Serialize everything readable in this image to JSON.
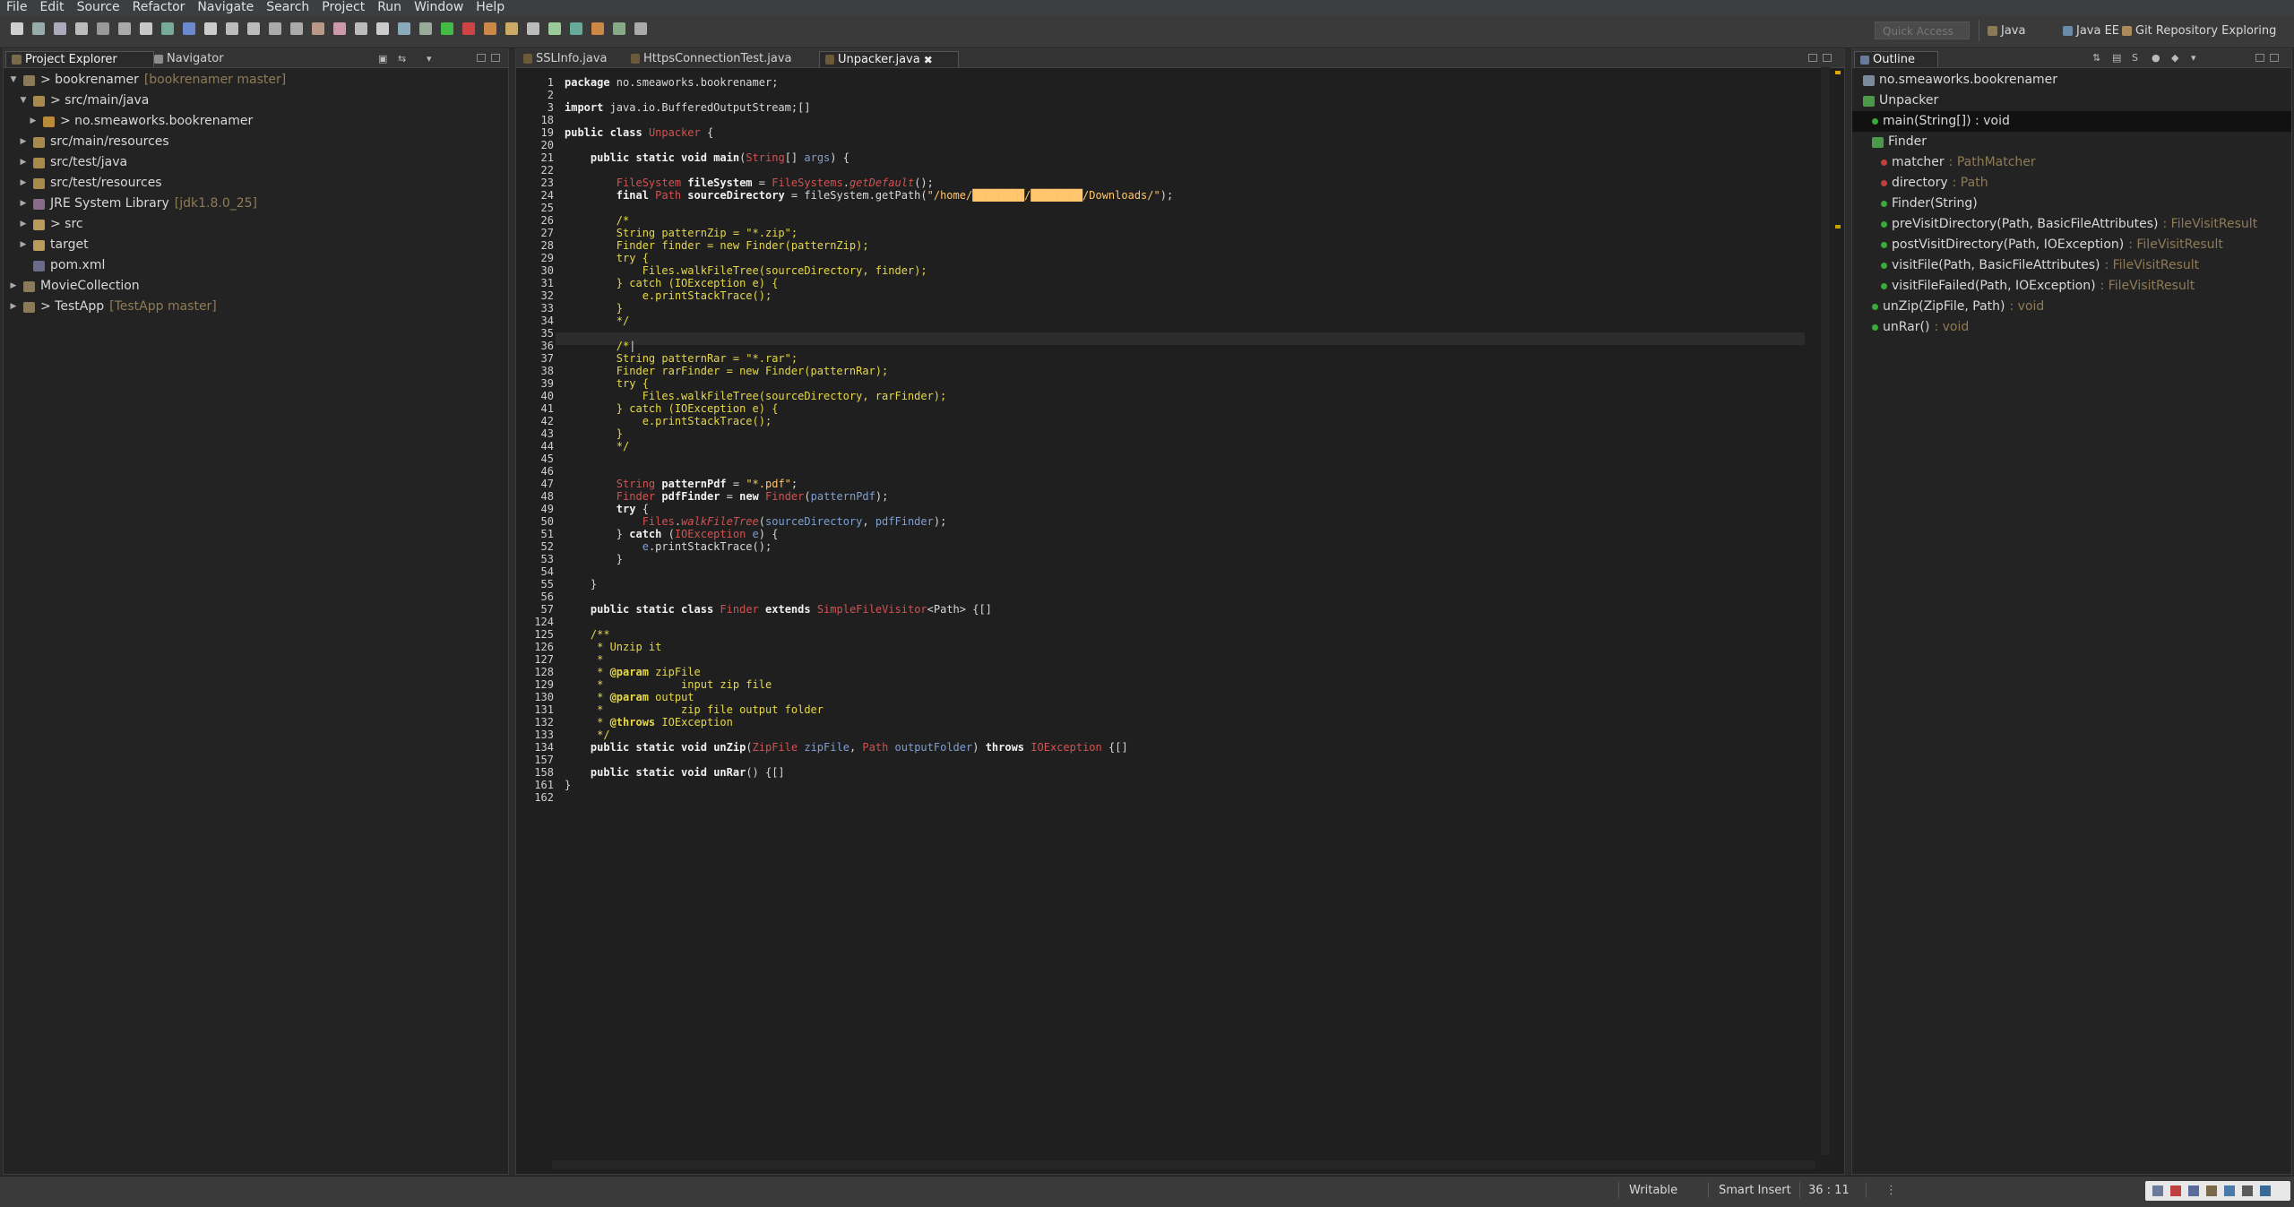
{
  "menu": [
    "File",
    "Edit",
    "Source",
    "Refactor",
    "Navigate",
    "Search",
    "Project",
    "Run",
    "Window",
    "Help"
  ],
  "toolbar": {
    "quick_access_placeholder": "Quick Access",
    "perspectives": [
      "Java",
      "Java EE",
      "Git Repository Exploring"
    ]
  },
  "left_panel": {
    "tabs": [
      "Project Explorer",
      "Navigator"
    ],
    "tree": [
      {
        "label": "> bookrenamer",
        "decoration": "[bookrenamer master]",
        "icon": "project-icon",
        "expanded": true
      },
      {
        "label": "> src/main/java",
        "icon": "source-folder-icon",
        "expanded": true
      },
      {
        "label": "> no.smeaworks.bookrenamer",
        "icon": "package-icon",
        "expanded": false
      },
      {
        "label": "src/main/resources",
        "icon": "source-folder-icon",
        "expanded": false
      },
      {
        "label": "src/test/java",
        "icon": "source-folder-icon",
        "expanded": false
      },
      {
        "label": "src/test/resources",
        "icon": "source-folder-icon",
        "expanded": false
      },
      {
        "label": "JRE System Library",
        "decoration": "[jdk1.8.0_25]",
        "icon": "library-icon",
        "expanded": false
      },
      {
        "label": "> src",
        "icon": "folder-icon",
        "expanded": false
      },
      {
        "label": "target",
        "icon": "folder-icon",
        "expanded": false
      },
      {
        "label": "pom.xml",
        "icon": "xml-file-icon",
        "expanded": false
      },
      {
        "label": "MovieCollection",
        "icon": "project-icon",
        "expanded": false
      },
      {
        "label": "> TestApp",
        "decoration": "[TestApp master]",
        "icon": "project-icon",
        "expanded": false
      }
    ]
  },
  "editor": {
    "tabs": [
      "SSLInfo.java",
      "HttpsConnectionTest.java",
      "Unpacker.java"
    ],
    "active_tab": "Unpacker.java",
    "lines": [
      {
        "n": "1",
        "html": "<span class='kw'>package</span> no.smeaworks.bookrenamer;"
      },
      {
        "n": "2",
        "html": ""
      },
      {
        "n": "3",
        "html": "<span class='kw'>import</span> java.io.BufferedOutputStream;[]"
      },
      {
        "n": "18",
        "html": ""
      },
      {
        "n": "19",
        "html": "<span class='kw'>public class</span> <span class='ty'>Unpacker</span> {"
      },
      {
        "n": "20",
        "html": ""
      },
      {
        "n": "21",
        "html": "    <span class='kw'>public static void</span> <span class='fn'>main</span>(<span class='ty'>String</span>[] <span class='var'>args</span>) {"
      },
      {
        "n": "22",
        "html": ""
      },
      {
        "n": "23",
        "html": "        <span class='ty'>FileSystem</span> <span class='fn'>fileSystem</span> = <span class='ty'>FileSystems</span>.<span class='it'>getDefault</span>();"
      },
      {
        "n": "24",
        "html": "        <span class='kw'>final</span> <span class='ty'>Path</span> <span class='fn'>sourceDirectory</span> = fileSystem.getPath(<span class='str'>\"/home/████████/████████/Downloads/\"</span>);"
      },
      {
        "n": "25",
        "html": ""
      },
      {
        "n": "26",
        "html": "        <span class='cm'>/*</span>"
      },
      {
        "n": "27",
        "html": "        <span class='cm'>String patternZip = \"*.zip\";</span>"
      },
      {
        "n": "28",
        "html": "        <span class='cm'>Finder finder = new Finder(patternZip);</span>"
      },
      {
        "n": "29",
        "html": "        <span class='cm'>try {</span>"
      },
      {
        "n": "30",
        "html": "            <span class='cm'>Files.walkFileTree(sourceDirectory, finder);</span>"
      },
      {
        "n": "31",
        "html": "        <span class='cm'>} catch (IOException e) {</span>"
      },
      {
        "n": "32",
        "html": "            <span class='cm'>e.printStackTrace();</span>"
      },
      {
        "n": "33",
        "html": "        <span class='cm'>}</span>"
      },
      {
        "n": "34",
        "html": "        <span class='cm'>*/</span>"
      },
      {
        "n": "35",
        "html": ""
      },
      {
        "n": "36",
        "html": "        <span class='cm'>/*</span>|"
      },
      {
        "n": "37",
        "html": "        <span class='cm'>String patternRar = \"*.rar\";</span>"
      },
      {
        "n": "38",
        "html": "        <span class='cm'>Finder rarFinder = new Finder(patternRar);</span>"
      },
      {
        "n": "39",
        "html": "        <span class='cm'>try {</span>"
      },
      {
        "n": "40",
        "html": "            <span class='cm'>Files.walkFileTree(sourceDirectory, rarFinder);</span>"
      },
      {
        "n": "41",
        "html": "        <span class='cm'>} catch (IOException e) {</span>"
      },
      {
        "n": "42",
        "html": "            <span class='cm'>e.printStackTrace();</span>"
      },
      {
        "n": "43",
        "html": "        <span class='cm'>}</span>"
      },
      {
        "n": "44",
        "html": "        <span class='cm'>*/</span>"
      },
      {
        "n": "45",
        "html": ""
      },
      {
        "n": "46",
        "html": ""
      },
      {
        "n": "47",
        "html": "        <span class='ty'>String</span> <span class='fn'>patternPdf</span> = <span class='str'>\"*.pdf\"</span>;"
      },
      {
        "n": "48",
        "html": "        <span class='ty'>Finder</span> <span class='fn'>pdfFinder</span> = <span class='kw'>new</span> <span class='ty'>Finder</span>(<span class='var'>patternPdf</span>);"
      },
      {
        "n": "49",
        "html": "        <span class='kw'>try</span> {"
      },
      {
        "n": "50",
        "html": "            <span class='ty'>Files</span>.<span class='it'>walkFileTree</span>(<span class='var'>sourceDirectory</span>, <span class='var'>pdfFinder</span>);"
      },
      {
        "n": "51",
        "html": "        } <span class='kw'>catch</span> (<span class='ty'>IOException</span> <span class='var'>e</span>) {"
      },
      {
        "n": "52",
        "html": "            <span class='var'>e</span>.printStackTrace();"
      },
      {
        "n": "53",
        "html": "        }"
      },
      {
        "n": "54",
        "html": ""
      },
      {
        "n": "55",
        "html": "    }"
      },
      {
        "n": "56",
        "html": ""
      },
      {
        "n": "57",
        "html": "    <span class='kw'>public static class</span> <span class='ty'>Finder</span> <span class='kw'>extends</span> <span class='ty'>SimpleFileVisitor</span>&lt;Path&gt; {[]"
      },
      {
        "n": "124",
        "html": ""
      },
      {
        "n": "125",
        "html": "    <span class='cm'>/**</span>"
      },
      {
        "n": "126",
        "html": "     <span class='cm'>* Unzip it</span>"
      },
      {
        "n": "127",
        "html": "     <span class='cm'>*</span>"
      },
      {
        "n": "128",
        "html": "     <span class='cm'>* </span><span class='ann'>@param</span> <span class='cm'>zipFile</span>"
      },
      {
        "n": "129",
        "html": "     <span class='cm'>*            input zip file</span>"
      },
      {
        "n": "130",
        "html": "     <span class='cm'>* </span><span class='ann'>@param</span> <span class='cm'>output</span>"
      },
      {
        "n": "131",
        "html": "     <span class='cm'>*            zip file output folder</span>"
      },
      {
        "n": "132",
        "html": "     <span class='cm'>* </span><span class='ann'>@throws</span> <span class='cm'>IOException</span>"
      },
      {
        "n": "133",
        "html": "     <span class='cm'>*/</span>"
      },
      {
        "n": "134",
        "html": "    <span class='kw'>public static void</span> <span class='fn'>unZip</span>(<span class='ty'>ZipFile</span> <span class='var'>zipFile</span>, <span class='ty'>Path</span> <span class='var'>outputFolder</span>) <span class='kw'>throws</span> <span class='ty'>IOException</span> {[]"
      },
      {
        "n": "157",
        "html": ""
      },
      {
        "n": "158",
        "html": "    <span class='kw'>public static void</span> <span class='fn'>unRar</span>() {[]"
      },
      {
        "n": "161",
        "html": "}"
      },
      {
        "n": "162",
        "html": ""
      }
    ]
  },
  "outline": {
    "tab": "Outline",
    "items": [
      {
        "label": "no.smeaworks.bookrenamer",
        "type": "",
        "indent": 0,
        "icon": "package-icon"
      },
      {
        "label": "Unpacker",
        "type": "",
        "indent": 0,
        "icon": "class-icon"
      },
      {
        "label": "main(String[]) : void",
        "type": "",
        "indent": 1,
        "icon": "method-icon",
        "selected": true
      },
      {
        "label": "Finder",
        "type": "",
        "indent": 1,
        "icon": "class-icon"
      },
      {
        "label": "matcher",
        "type": ": PathMatcher",
        "indent": 2,
        "icon": "field-icon"
      },
      {
        "label": "directory",
        "type": ": Path",
        "indent": 2,
        "icon": "field-icon"
      },
      {
        "label": "Finder(String)",
        "type": "",
        "indent": 2,
        "icon": "constructor-icon"
      },
      {
        "label": "preVisitDirectory(Path, BasicFileAttributes)",
        "type": ": FileVisitResult",
        "indent": 2,
        "icon": "method-icon"
      },
      {
        "label": "postVisitDirectory(Path, IOException)",
        "type": ": FileVisitResult",
        "indent": 2,
        "icon": "method-icon"
      },
      {
        "label": "visitFile(Path, BasicFileAttributes)",
        "type": ": FileVisitResult",
        "indent": 2,
        "icon": "method-icon"
      },
      {
        "label": "visitFileFailed(Path, IOException)",
        "type": ": FileVisitResult",
        "indent": 2,
        "icon": "method-icon"
      },
      {
        "label": "unZip(ZipFile, Path)",
        "type": ": void",
        "indent": 1,
        "icon": "method-icon"
      },
      {
        "label": "unRar()",
        "type": ": void",
        "indent": 1,
        "icon": "method-icon"
      }
    ]
  },
  "status": {
    "writable": "Writable",
    "insert_mode": "Smart Insert",
    "position": "36 : 11"
  }
}
